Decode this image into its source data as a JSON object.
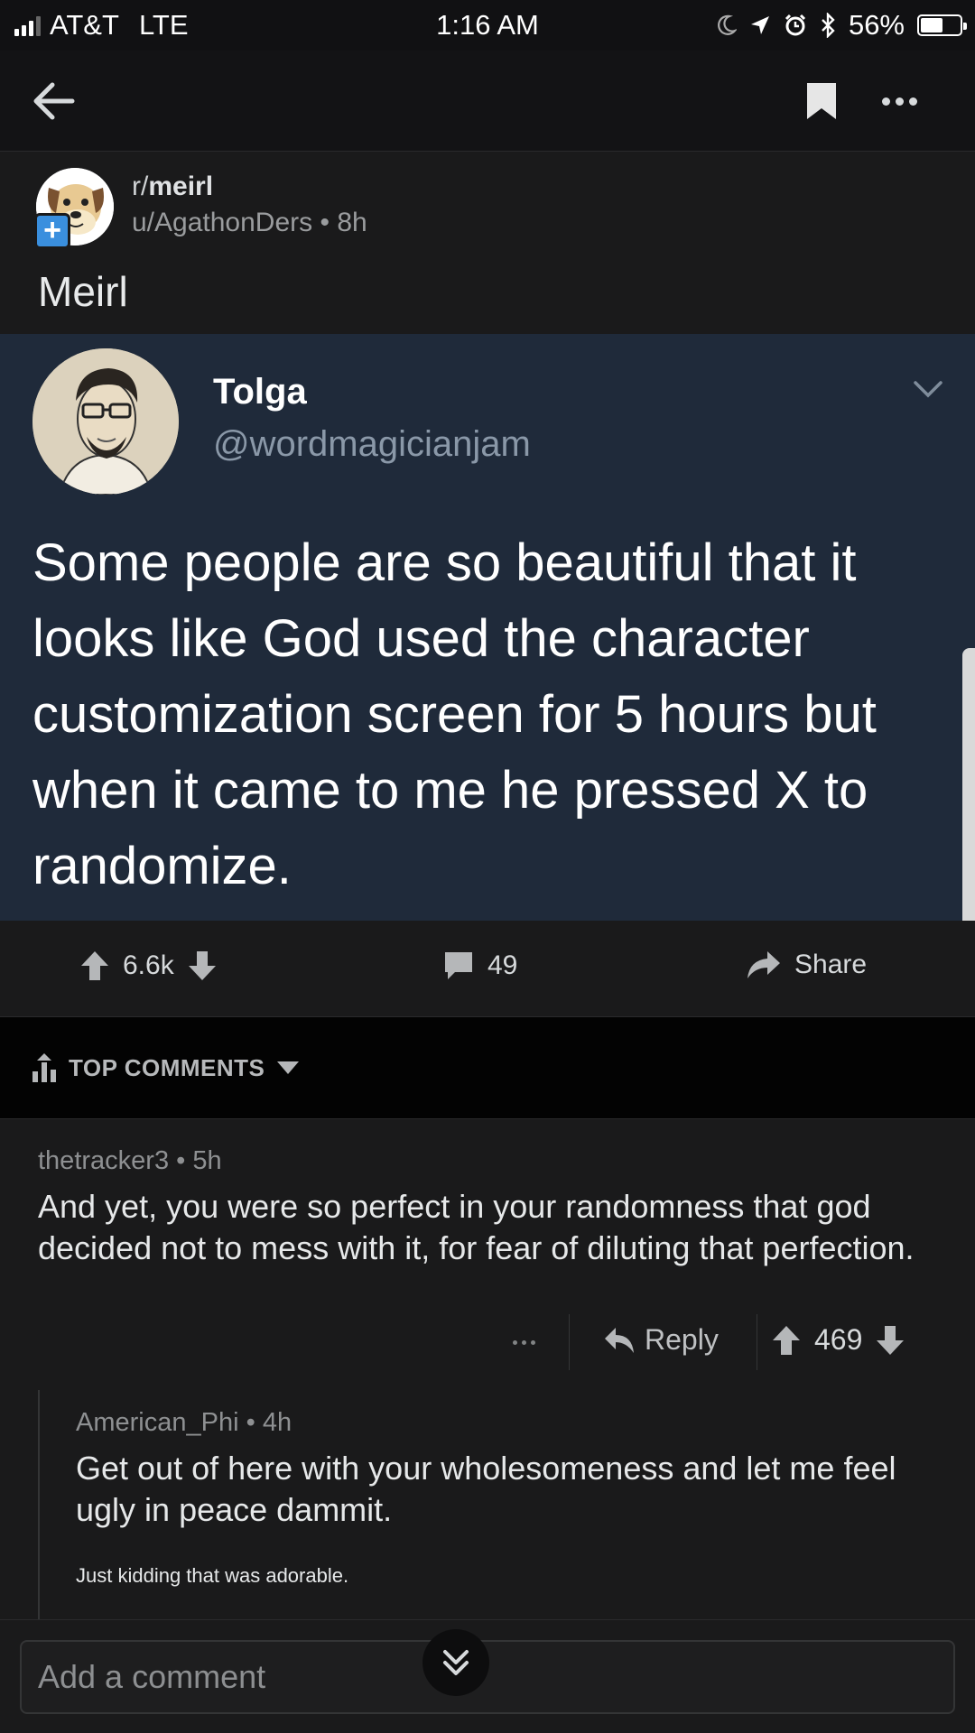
{
  "status_bar": {
    "carrier": "AT&T",
    "network": "LTE",
    "time": "1:16 AM",
    "battery_text": "56%",
    "battery_level": 0.56
  },
  "nav": {
    "icons": [
      "back-arrow-icon",
      "bookmark-icon",
      "more-icon"
    ]
  },
  "post": {
    "subreddit_prefix": "r/",
    "subreddit_name": "meirl",
    "author": "u/AgathonDers",
    "age": "8h",
    "title": "Meirl",
    "join_label": "+",
    "tweet": {
      "name": "Tolga",
      "handle": "@wordmagicianjam",
      "text": "Some people are so beautiful that it looks like God used the character customization screen for 5 hours but when it came to me he pressed X to randomize."
    },
    "score": "6.6k",
    "comment_count": "49",
    "share_label": "Share"
  },
  "sort": {
    "label": "TOP COMMENTS"
  },
  "comments": [
    {
      "author": "thetracker3",
      "age": "5h",
      "body": "And yet, you were so perfect in your randomness that god decided not to mess with it, for fear of diluting that perfection.",
      "reply_label": "Reply",
      "score": "469"
    },
    {
      "author": "American_Phi",
      "age": "4h",
      "body": "Get out of here with your wholesomeness and let me feel ugly in peace dammit.",
      "small_text": "Just kidding that was adorable."
    }
  ],
  "comment_bar": {
    "placeholder": "Add a comment"
  },
  "colors": {
    "background": "#1a1a1b",
    "tweet_background": "#1f2a3a",
    "sort_bar": "#030303",
    "join_button": "#3a8fde"
  }
}
